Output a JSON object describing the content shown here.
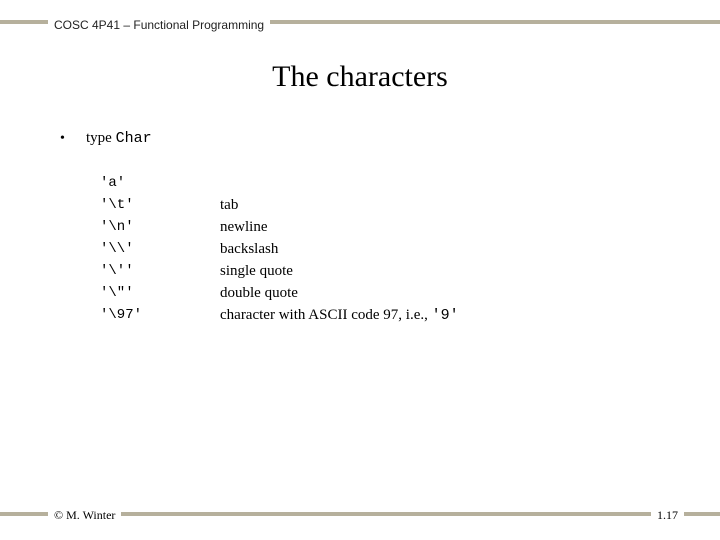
{
  "header": {
    "course": "COSC 4P41 – Functional Programming"
  },
  "title": "The characters",
  "type_line": {
    "keyword": "type ",
    "typename": "Char"
  },
  "rows": [
    {
      "literal": "'a'",
      "desc": ""
    },
    {
      "literal": "'\\t'",
      "desc": "tab"
    },
    {
      "literal": "'\\n'",
      "desc": "newline"
    },
    {
      "literal": "'\\\\'",
      "desc": "backslash"
    },
    {
      "literal": "'\\''",
      "desc": "single quote"
    },
    {
      "literal": "'\\\"'",
      "desc": "double quote"
    },
    {
      "literal": "'\\97'",
      "desc": "character with ASCII code 97, i.e., ",
      "desc_mono": "'9'"
    }
  ],
  "footer": {
    "left": "© M. Winter",
    "right": "1.17"
  }
}
